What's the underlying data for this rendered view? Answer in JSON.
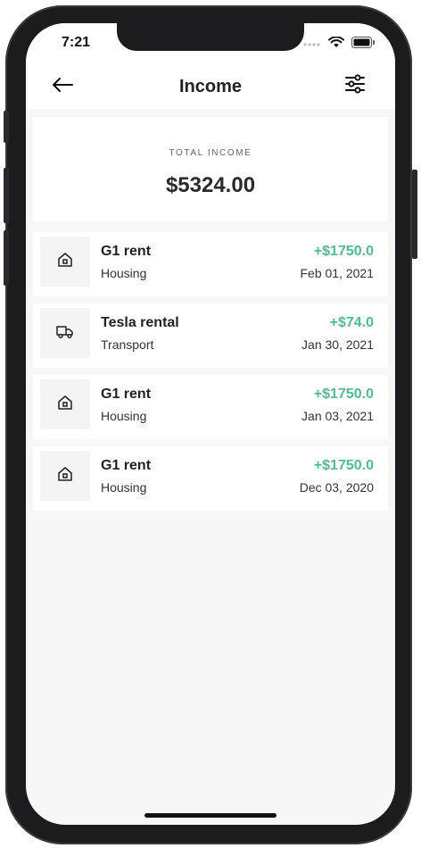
{
  "status_bar": {
    "time": "7:21",
    "icons": [
      "cellular-signal-icon",
      "wifi-icon",
      "battery-icon"
    ]
  },
  "header": {
    "title": "Income",
    "back_icon": "arrow-left-icon",
    "filter_icon": "sliders-icon"
  },
  "summary": {
    "label": "TOTAL INCOME",
    "value": "$5324.00"
  },
  "transactions": [
    {
      "title": "G1 rent",
      "category": "Housing",
      "amount": "+$1750.0",
      "date": "Feb 01, 2021",
      "icon": "house-icon"
    },
    {
      "title": "Tesla rental",
      "category": "Transport",
      "amount": "+$74.0",
      "date": "Jan 30, 2021",
      "icon": "truck-icon"
    },
    {
      "title": "G1 rent",
      "category": "Housing",
      "amount": "+$1750.0",
      "date": "Jan 03, 2021",
      "icon": "house-icon"
    },
    {
      "title": "G1 rent",
      "category": "Housing",
      "amount": "+$1750.0",
      "date": "Dec 03, 2020",
      "icon": "house-icon"
    }
  ],
  "colors": {
    "amount_positive": "#4cc28a",
    "background": "#f7f7f7",
    "card": "#ffffff",
    "icon_box": "#f4f4f4"
  }
}
